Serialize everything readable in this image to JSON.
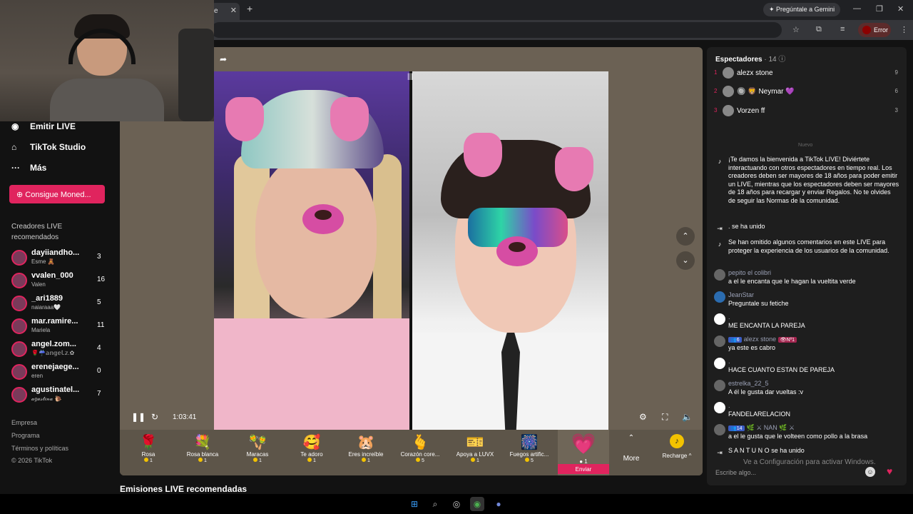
{
  "browser": {
    "tab_label": "e",
    "tab_close": "✕",
    "new_tab": "+",
    "gemini_label": "Pregúntale a Gemini",
    "error_label": "Error",
    "win_min": "—",
    "win_max": "❐",
    "win_close": "✕"
  },
  "sidebar": {
    "nav": [
      {
        "icon": "◉",
        "label": "Emitir LIVE"
      },
      {
        "icon": "⌂",
        "label": "TikTok Studio"
      },
      {
        "icon": "···",
        "label": "Más"
      }
    ],
    "coins_button": "Consigue Moned...",
    "section_title": "Creadores LIVE recomendados",
    "creators": [
      {
        "name": "dayiiandho...",
        "sub": "Esme 🧸",
        "count": "3"
      },
      {
        "name": "vvalen_000",
        "sub": "Valen",
        "count": "16"
      },
      {
        "name": "_ari1889",
        "sub": "naiaraaa🤍",
        "count": "5"
      },
      {
        "name": "mar.ramire...",
        "sub": "Mariela",
        "count": "11"
      },
      {
        "name": "angel.zom...",
        "sub": "🌹☔𝕒𝕟𝕘𝕖𝕝.𝕫.✿",
        "count": "4"
      },
      {
        "name": "erenejaege...",
        "sub": "eren",
        "count": "0"
      },
      {
        "name": "agustinatel...",
        "sub": "𝒶𝑔𝓊𝓈𝓉𝒾𝓃𝒶 🐌",
        "count": "7"
      }
    ],
    "footer": [
      "Empresa",
      "Programa",
      "Términos y políticas",
      "© 2026 TikTok"
    ]
  },
  "player": {
    "time": "1:03:41",
    "gifts": [
      {
        "icon": "🌹",
        "name": "Rosa",
        "price": "1"
      },
      {
        "icon": "💐",
        "name": "Rosa blanca",
        "price": "1"
      },
      {
        "icon": "🪇",
        "name": "Maracas",
        "price": "1"
      },
      {
        "icon": "🥰",
        "name": "Te adoro",
        "price": "1"
      },
      {
        "icon": "🐹",
        "name": "Eres increíble",
        "price": "1"
      },
      {
        "icon": "🫰",
        "name": "Corazón core...",
        "price": "5"
      },
      {
        "icon": "🎫",
        "name": "Apoya a LUVX",
        "price": "1"
      },
      {
        "icon": "🎆",
        "name": "Fuegos artific...",
        "price": "5"
      }
    ],
    "featured_gift": {
      "icon": "💗",
      "price": "1",
      "send": "Enviar"
    },
    "more_label": "More",
    "recharge_label": "Recharge ^"
  },
  "rec_heading": "Emisiones LIVE recomendadas",
  "chat": {
    "viewers_label": "Espectadores",
    "viewers_count": "· 14",
    "viewers": [
      {
        "rank": "1",
        "name": "alezx stone",
        "score": "9"
      },
      {
        "rank": "2",
        "name": "🔘 🦁 Neymar 💜",
        "score": "6"
      },
      {
        "rank": "3",
        "name": "Vorzen ff",
        "score": "3"
      }
    ],
    "divider": "Nuevo",
    "messages": [
      {
        "icon": "♪",
        "user": "",
        "text": "¡Te damos la bienvenida a TikTok LIVE! Diviértete interactuando con otros espectadores en tiempo real. Los creadores deben ser mayores de 18 años para poder emitir un LIVE, mientras que los espectadores deben ser mayores de 18 años para recargar y enviar Regalos. No te olvides de seguir las Normas de la comunidad."
      },
      {
        "icon": "⇥",
        "user": "",
        "text": ".  se ha unido"
      },
      {
        "icon": "♪",
        "user": "",
        "text": "Se han omitido algunos comentarios en este LIVE para proteger la experiencia de los usuarios de la comunidad."
      },
      {
        "icon": "",
        "user": "pepito el colibri",
        "text": "a el le encanta que le hagan la vueltita verde"
      },
      {
        "icon": "",
        "user": "JeanStar",
        "text": "Preguntale su fetiche"
      },
      {
        "icon": "",
        "user": ".",
        "text": "ME ENCANTA LA PAREJA"
      },
      {
        "icon": "",
        "user": "alezx stone",
        "text": "ya este es cabro"
      },
      {
        "icon": "",
        "user": ".",
        "text": "HACE CUANTO ESTAN DE PAREJA"
      },
      {
        "icon": "",
        "user": "estrelka_22_5",
        "text": "A él le gusta dar vueltas :v"
      },
      {
        "icon": "",
        "user": ".",
        "text": "FANDELARELACION"
      },
      {
        "icon": "",
        "user": "🌿 ⚔ NAN 🌿 ⚔",
        "text": "a el le gusta que le volteen como pollo a la brasa"
      },
      {
        "icon": "⇥",
        "user": "",
        "text": "S A N T U N O    se ha unido"
      }
    ],
    "badges": {
      "alezx": "6",
      "alezx_rank": "Nº1",
      "nan": "14"
    },
    "input_placeholder": "Escribe algo...",
    "activate_notice": "Ve a Configuración para activar Windows."
  }
}
